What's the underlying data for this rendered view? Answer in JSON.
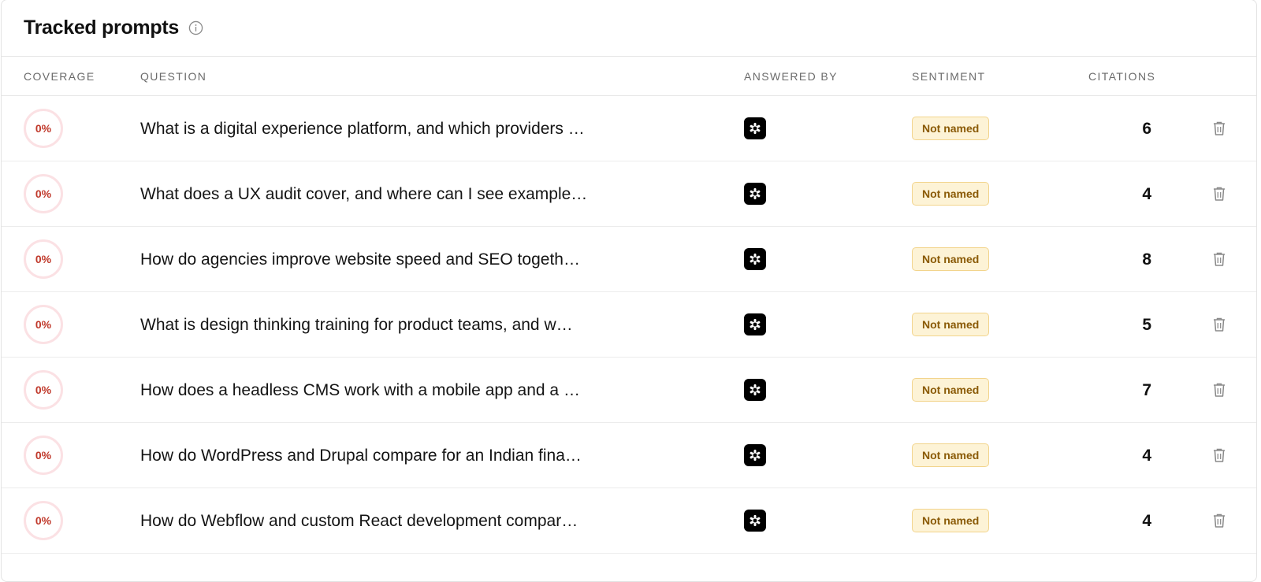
{
  "header": {
    "title": "Tracked prompts",
    "info_icon": "info-icon"
  },
  "columns": {
    "coverage": "COVERAGE",
    "question": "QUESTION",
    "answered_by": "ANSWERED BY",
    "sentiment": "SENTIMENT",
    "citations": "CITATIONS"
  },
  "rows": [
    {
      "coverage": "0%",
      "question": "What is a digital experience platform, and which providers …",
      "answered_by_icon": "openai-icon",
      "sentiment": "Not named",
      "citations": "6"
    },
    {
      "coverage": "0%",
      "question": "What does a UX audit cover, and where can I see example…",
      "answered_by_icon": "openai-icon",
      "sentiment": "Not named",
      "citations": "4"
    },
    {
      "coverage": "0%",
      "question": "How do agencies improve website speed and SEO togeth…",
      "answered_by_icon": "openai-icon",
      "sentiment": "Not named",
      "citations": "8"
    },
    {
      "coverage": "0%",
      "question": "What is design thinking training for product teams, and w…",
      "answered_by_icon": "openai-icon",
      "sentiment": "Not named",
      "citations": "5"
    },
    {
      "coverage": "0%",
      "question": "How does a headless CMS work with a mobile app and a …",
      "answered_by_icon": "openai-icon",
      "sentiment": "Not named",
      "citations": "7"
    },
    {
      "coverage": "0%",
      "question": "How do WordPress and Drupal compare for an Indian fina…",
      "answered_by_icon": "openai-icon",
      "sentiment": "Not named",
      "citations": "4"
    },
    {
      "coverage": "0%",
      "question": "How do Webflow and custom React development compar…",
      "answered_by_icon": "openai-icon",
      "sentiment": "Not named",
      "citations": "4"
    }
  ],
  "colors": {
    "coverage_text": "#c0392b",
    "coverage_ring": "#fbe1e4",
    "badge_bg": "#fdf3d6",
    "badge_border": "#f2d48c",
    "badge_text": "#8a5a06"
  }
}
